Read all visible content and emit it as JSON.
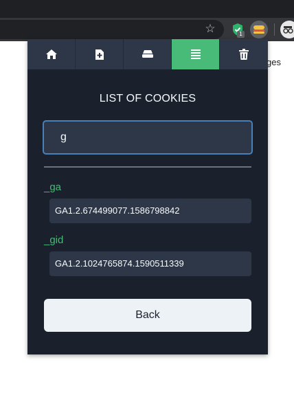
{
  "browser": {
    "extension_badge": "1",
    "page_text_behind": "ges"
  },
  "popup": {
    "tabs": [
      {
        "icon": "home-icon",
        "active": false
      },
      {
        "icon": "file-plus-icon",
        "active": false
      },
      {
        "icon": "stack-icon",
        "active": false
      },
      {
        "icon": "list-icon",
        "active": true
      },
      {
        "icon": "trash-icon",
        "active": false
      }
    ],
    "title": "LIST OF COOKIES",
    "search": {
      "value": "g",
      "placeholder": ""
    },
    "cookies": [
      {
        "name": "_ga",
        "value": "GA1.2.674499077.1586798842"
      },
      {
        "name": "_gid",
        "value": "GA1.2.1024765874.1590511339"
      }
    ],
    "back_label": "Back"
  },
  "colors": {
    "popup_bg": "#1a202c",
    "panel_bg": "#2d3748",
    "accent_green": "#48bb78",
    "focus_border": "#4a80b8",
    "button_bg": "#edf2f7"
  }
}
